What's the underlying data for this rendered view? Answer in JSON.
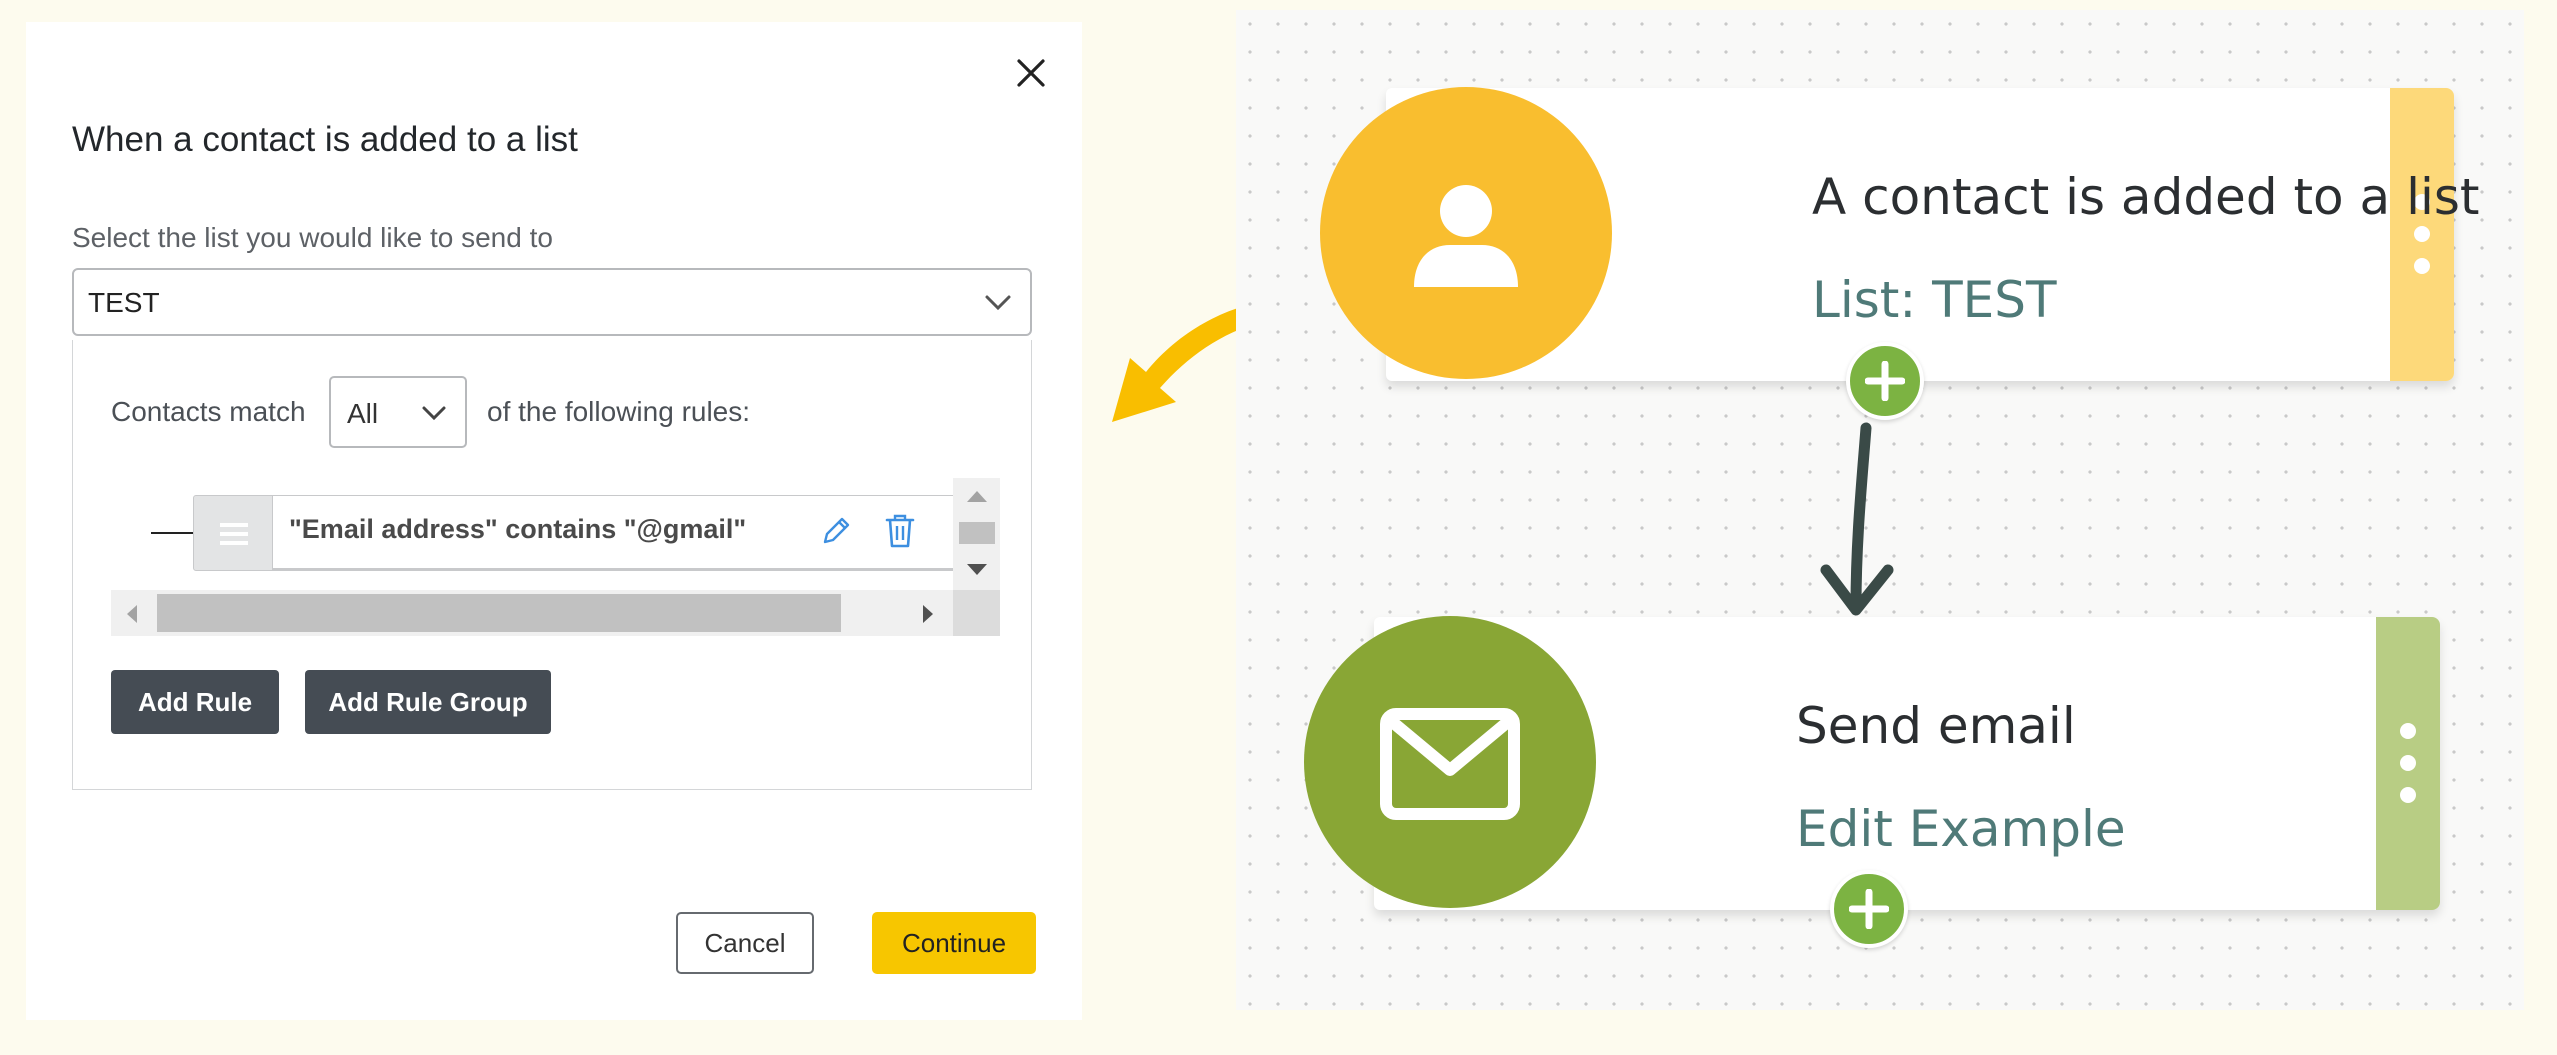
{
  "modal": {
    "title": "When a contact is added to a list",
    "close_icon": "close-icon",
    "list_label": "Select the list you would like to send to",
    "list_value": "TEST",
    "match_prefix": "Contacts match",
    "match_value": "All",
    "match_suffix": "of the following rules:",
    "rules": [
      {
        "text": "\"Email address\" contains \"@gmail\""
      }
    ],
    "add_rule_label": "Add Rule",
    "add_rule_group_label": "Add Rule Group",
    "cancel_label": "Cancel",
    "continue_label": "Continue"
  },
  "workflow": {
    "nodes": [
      {
        "title": "A contact is added to a list",
        "subtitle": "List: TEST",
        "icon": "person-icon",
        "color": "#f9be2f",
        "strip_color": "#fdd97a"
      },
      {
        "title": "Send email",
        "subtitle": "Edit Example",
        "icon": "envelope-icon",
        "color": "#89a635",
        "strip_color": "#b8cd84"
      }
    ]
  },
  "colors": {
    "accent_yellow": "#f7c600",
    "plus_green": "#7cb342",
    "dark_button": "#454c54",
    "arrow_yellow": "#f9be00"
  }
}
